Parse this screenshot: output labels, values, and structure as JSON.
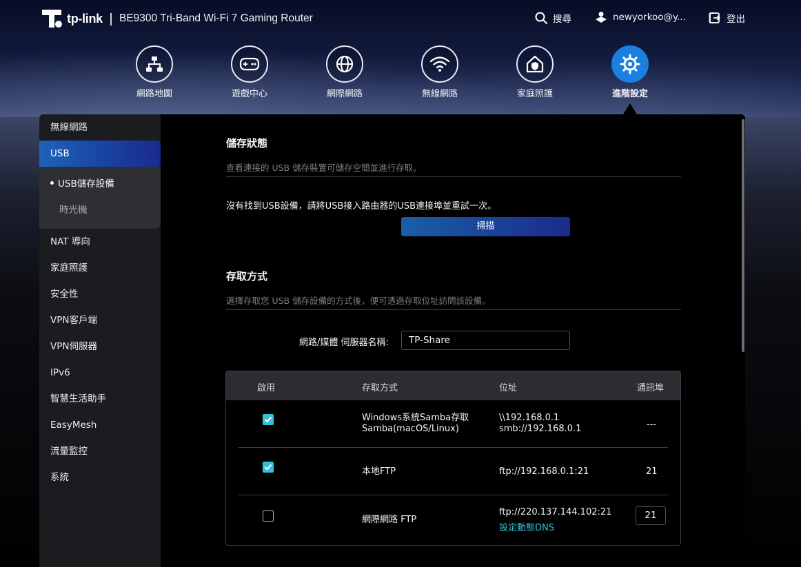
{
  "header": {
    "logo_text": "tp-link",
    "product_name": "BE9300 Tri-Band Wi-Fi 7 Gaming Router",
    "search_label": "搜尋",
    "user_label": "newyorkoo@y...",
    "logout_label": "登出"
  },
  "nav": {
    "items": [
      {
        "label": "網路地圖",
        "icon": "network-map-icon"
      },
      {
        "label": "遊戲中心",
        "icon": "gamepad-icon"
      },
      {
        "label": "網際網路",
        "icon": "globe-icon"
      },
      {
        "label": "無線網路",
        "icon": "wifi-icon"
      },
      {
        "label": "家庭照護",
        "icon": "home-shield-icon"
      },
      {
        "label": "進階設定",
        "icon": "gear-icon",
        "active": true
      }
    ]
  },
  "sidebar": {
    "items": [
      {
        "label": "無線網路"
      },
      {
        "label": "USB",
        "selected": true
      },
      {
        "label": "NAT 導向"
      },
      {
        "label": "家庭照護"
      },
      {
        "label": "安全性"
      },
      {
        "label": "VPN客戶端"
      },
      {
        "label": "VPN伺服器"
      },
      {
        "label": "IPv6"
      },
      {
        "label": "智慧生活助手"
      },
      {
        "label": "EasyMesh"
      },
      {
        "label": "流量監控"
      },
      {
        "label": "系統"
      }
    ],
    "sub_items": [
      {
        "label": "USB儲存設備",
        "active": true
      },
      {
        "label": "時光機"
      }
    ]
  },
  "storage": {
    "title": "儲存狀態",
    "description": "查看連接的 USB 儲存裝置可儲存空間並進行存取。",
    "message": "沒有找到USB設備，請將USB接入路由器的USB連接埠並重試一次。",
    "scan_label": "掃描"
  },
  "access": {
    "title": "存取方式",
    "description": "選擇存取您 USB 儲存設備的方式後，便可透過存取位址訪問該設備。",
    "server_label": "網路/媒體 伺服器名稱:",
    "server_value": "TP-Share",
    "table": {
      "headers": [
        "啟用",
        "存取方式",
        "位址",
        "通訊埠"
      ],
      "rows": [
        {
          "enabled": true,
          "method_1": "Windows系統Samba存取",
          "method_2": "Samba(macOS/Linux)",
          "address_1": "\\\\192.168.0.1",
          "address_2": "smb://192.168.0.1",
          "port": "---"
        },
        {
          "enabled": true,
          "method_1": "本地FTP",
          "address_1": "ftp://192.168.0.1:21",
          "port": "21"
        },
        {
          "enabled": false,
          "method_1": "網際網路 FTP",
          "address_1": "ftp://220.137.144.102:21",
          "address_link": "設定動態DNS",
          "port": "21"
        }
      ]
    }
  },
  "colors": {
    "accent": "#33c2d9",
    "primary_button": "#1a5ea9",
    "active_nav": "#1d7fdd"
  }
}
